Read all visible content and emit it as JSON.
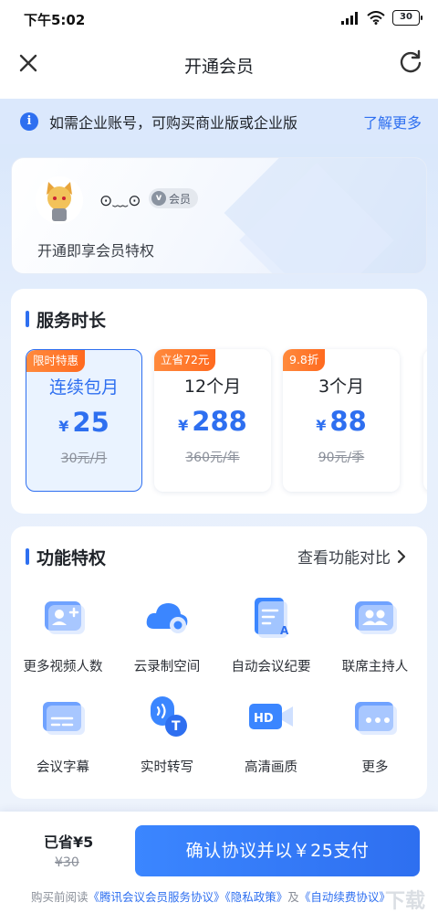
{
  "status_bar": {
    "time": "下午5:02",
    "battery": "30"
  },
  "nav": {
    "title": "开通会员"
  },
  "notice": {
    "text": "如需企业账号，可购买商业版或企业版",
    "link": "了解更多"
  },
  "user": {
    "nickname": "⊙﹏⊙",
    "badge": "会员",
    "badge_letter": "v",
    "subtitle": "开通即享会员特权"
  },
  "service": {
    "title": "服务时长",
    "plans": [
      {
        "tag": "限时特惠",
        "name": "连续包月",
        "currency": "¥",
        "price": "25",
        "original": "30元/月",
        "selected": true
      },
      {
        "tag": "立省72元",
        "name": "12个月",
        "currency": "¥",
        "price": "288",
        "original": "360元/年",
        "selected": false
      },
      {
        "tag": "9.8折",
        "name": "3个月",
        "currency": "¥",
        "price": "88",
        "original": "90元/季",
        "selected": false
      }
    ]
  },
  "features": {
    "title": "功能特权",
    "compare": "查看功能对比",
    "items": [
      {
        "label": "更多视频人数",
        "icon": "video-participants-icon"
      },
      {
        "label": "云录制空间",
        "icon": "cloud-recording-icon"
      },
      {
        "label": "自动会议纪要",
        "icon": "meeting-minutes-icon"
      },
      {
        "label": "联席主持人",
        "icon": "co-host-icon"
      },
      {
        "label": "会议字幕",
        "icon": "subtitles-icon"
      },
      {
        "label": "实时转写",
        "icon": "transcription-icon"
      },
      {
        "label": "高清画质",
        "icon": "hd-video-icon"
      },
      {
        "label": "更多",
        "icon": "more-icon"
      }
    ]
  },
  "bottom": {
    "saved": "已省¥5",
    "original_total": "¥30",
    "pay_button": "确认协议并以￥25支付",
    "agreement_prefix": "购买前阅读",
    "agreement_link1": "《腾讯会议会员服务协议》",
    "agreement_link2": "《隐私政策》",
    "agreement_and": "及",
    "agreement_link3": "《自动续费协议》"
  },
  "watermark": "下载",
  "colors": {
    "accent": "#2e6ff0",
    "tag_orange": "#ff7a2e"
  }
}
